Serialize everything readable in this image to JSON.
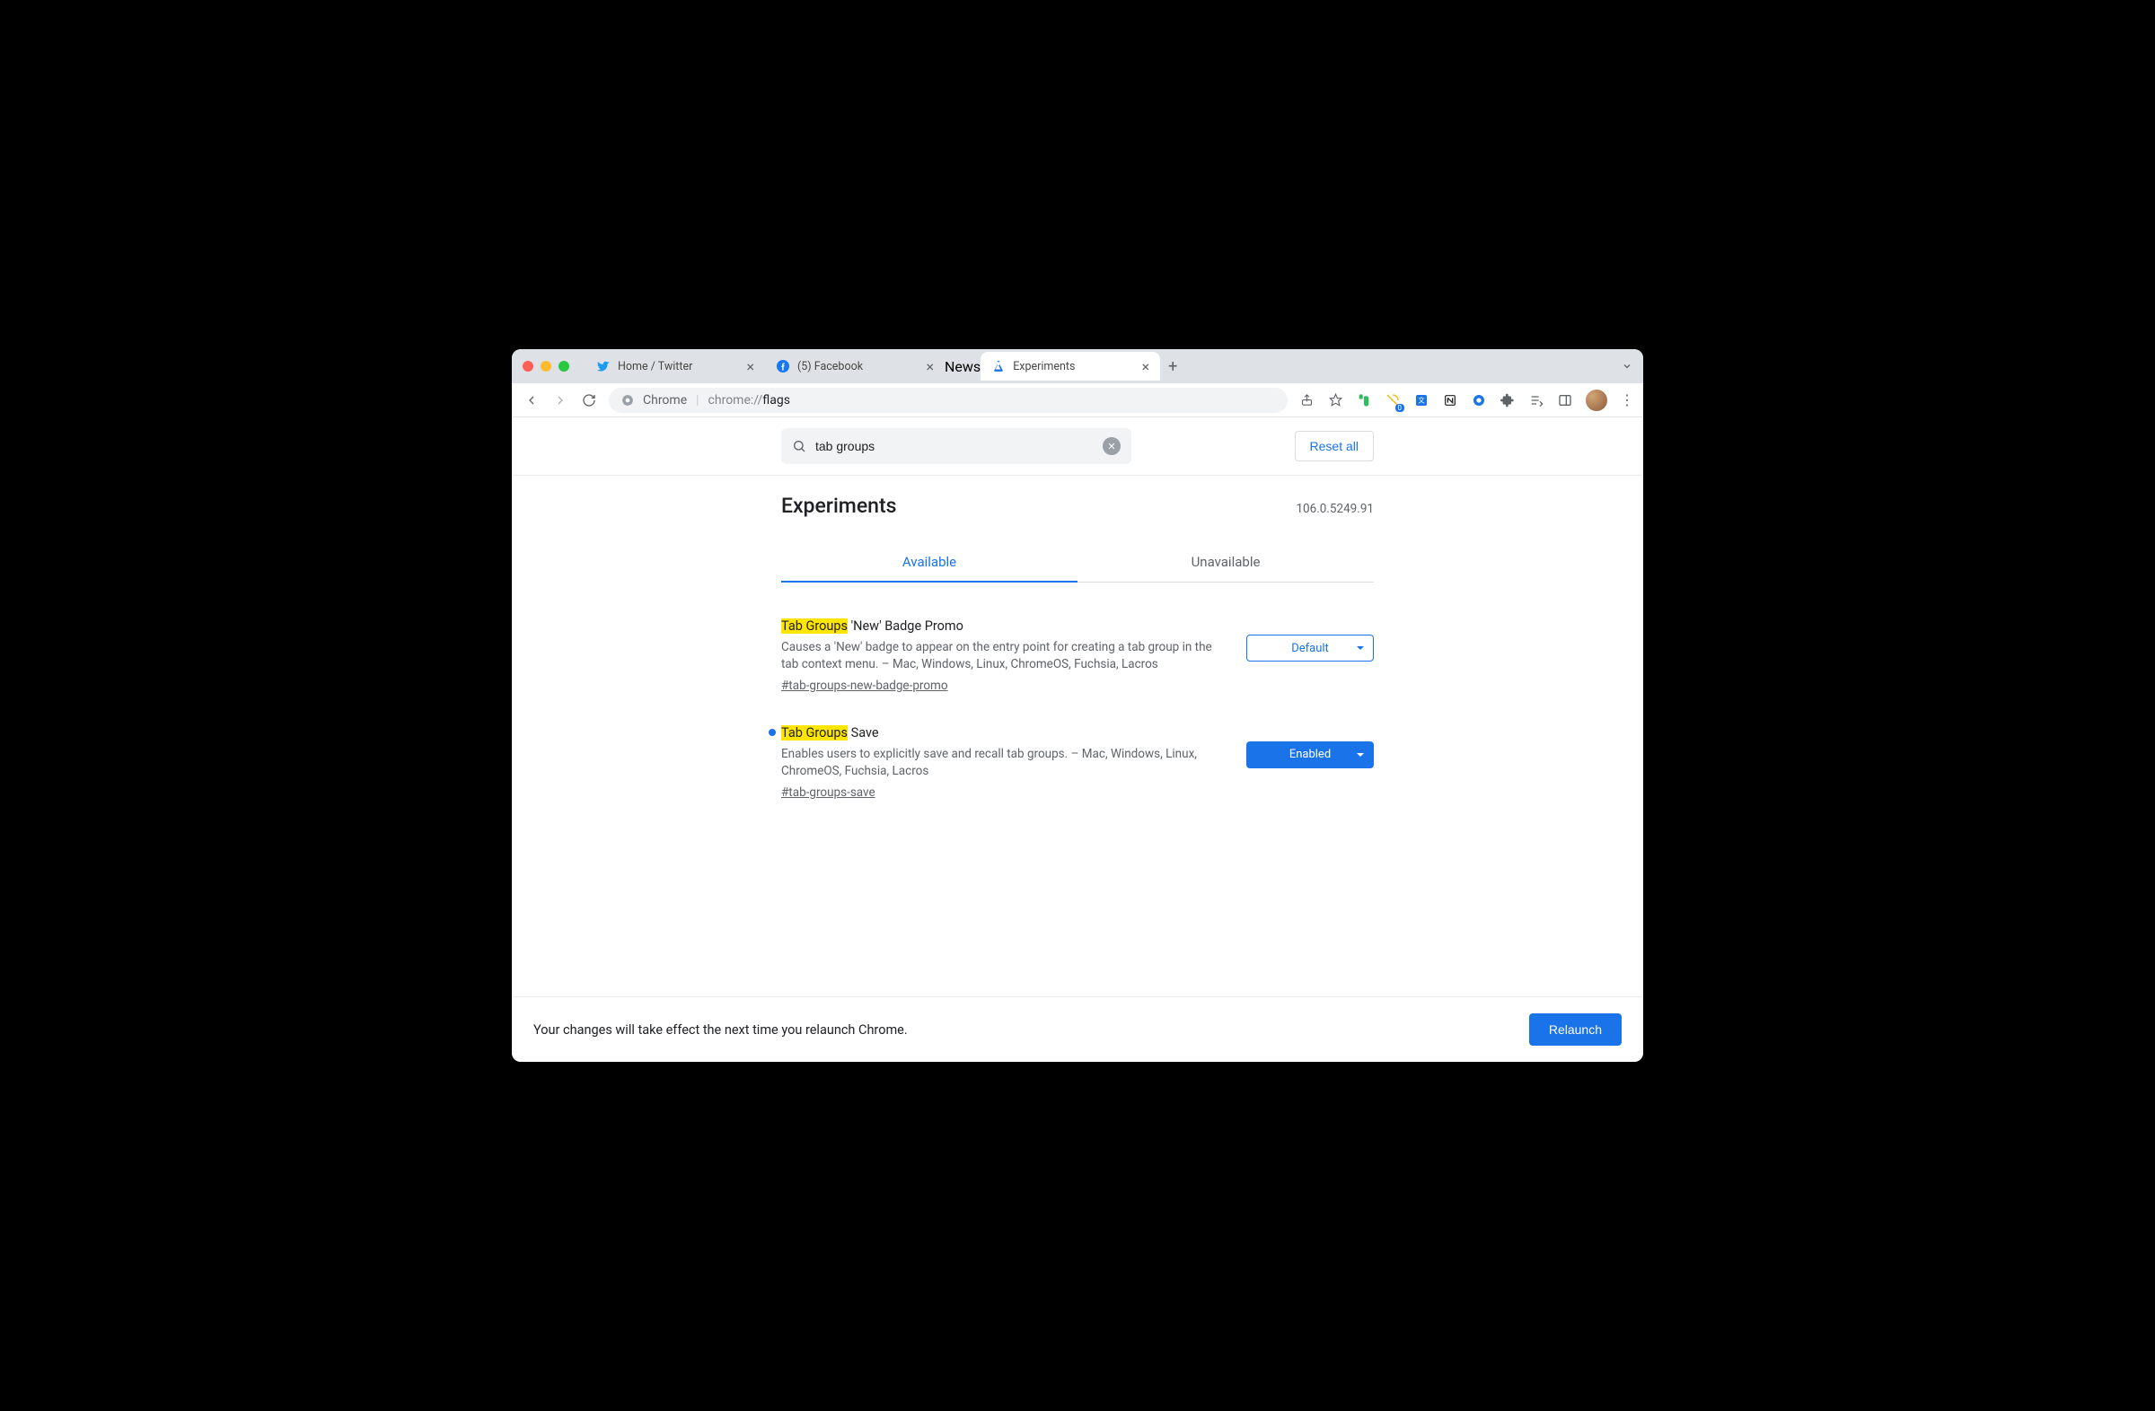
{
  "tabs": [
    {
      "label": "Home / Twitter",
      "favicon": "twitter"
    },
    {
      "label": "(5) Facebook",
      "favicon": "facebook"
    }
  ],
  "group_chip": "News",
  "active_tab": {
    "label": "Experiments",
    "favicon": "flask"
  },
  "address": {
    "chrome_label": "Chrome",
    "url_prefix": "chrome://",
    "url_path": "flags"
  },
  "search": {
    "value": "tab groups"
  },
  "reset_label": "Reset all",
  "page_title": "Experiments",
  "version": "106.0.5249.91",
  "subtabs": {
    "available": "Available",
    "unavailable": "Unavailable"
  },
  "flags": [
    {
      "title_highlight": "Tab Groups",
      "title_rest": " 'New' Badge Promo",
      "description": "Causes a 'New' badge to appear on the entry point for creating a tab group in the tab context menu. – Mac, Windows, Linux, ChromeOS, Fuchsia, Lacros",
      "hash": "#tab-groups-new-badge-promo",
      "value": "Default",
      "modified": false
    },
    {
      "title_highlight": "Tab Groups",
      "title_rest": " Save",
      "description": "Enables users to explicitly save and recall tab groups. – Mac, Windows, Linux, ChromeOS, Fuchsia, Lacros",
      "hash": "#tab-groups-save",
      "value": "Enabled",
      "modified": true
    }
  ],
  "footer": {
    "message": "Your changes will take effect the next time you relaunch Chrome.",
    "button": "Relaunch"
  }
}
